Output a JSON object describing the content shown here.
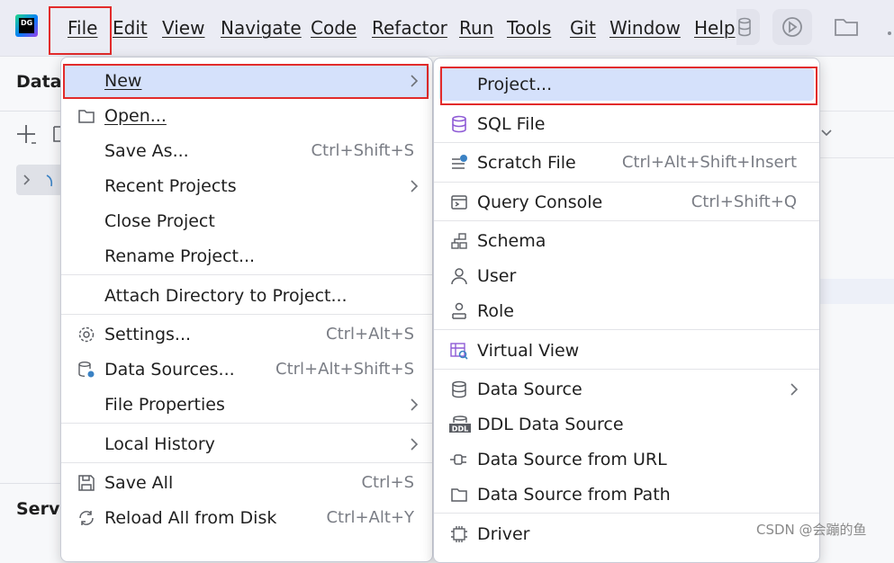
{
  "menubar": {
    "app_logo_text": "DG",
    "items": [
      "File",
      "Edit",
      "View",
      "Navigate",
      "Code",
      "Refactor",
      "Run",
      "Tools",
      "Git",
      "Window",
      "Help"
    ],
    "toolbar_icons": [
      "database-icon",
      "run-icon",
      "folder-icon"
    ]
  },
  "left_panel": {
    "title": "Data",
    "services_title": "Servi"
  },
  "file_menu": {
    "items": [
      {
        "label": "New",
        "shortcut": "",
        "icon": "",
        "submenu": true,
        "selected": true
      },
      {
        "label": "Open...",
        "shortcut": "",
        "icon": "folder-icon",
        "submenu": false
      },
      {
        "label": "Save As...",
        "shortcut": "Ctrl+Shift+S",
        "icon": "",
        "submenu": false
      },
      {
        "label": "Recent Projects",
        "shortcut": "",
        "icon": "",
        "submenu": true
      },
      {
        "label": "Close Project",
        "shortcut": "",
        "icon": "",
        "submenu": false
      },
      {
        "label": "Rename Project...",
        "shortcut": "",
        "icon": "",
        "submenu": false
      },
      {
        "label": "Attach Directory to Project...",
        "shortcut": "",
        "icon": "",
        "submenu": false
      },
      {
        "label": "Settings...",
        "shortcut": "Ctrl+Alt+S",
        "icon": "gear-icon",
        "submenu": false
      },
      {
        "label": "Data Sources...",
        "shortcut": "Ctrl+Alt+Shift+S",
        "icon": "data-sources-icon",
        "submenu": false
      },
      {
        "label": "File Properties",
        "shortcut": "",
        "icon": "",
        "submenu": true
      },
      {
        "label": "Local History",
        "shortcut": "",
        "icon": "",
        "submenu": true
      },
      {
        "label": "Save All",
        "shortcut": "Ctrl+S",
        "icon": "save-icon",
        "submenu": false
      },
      {
        "label": "Reload All from Disk",
        "shortcut": "Ctrl+Alt+Y",
        "icon": "reload-icon",
        "submenu": false
      }
    ]
  },
  "new_menu": {
    "items": [
      {
        "label": "Project...",
        "shortcut": "",
        "icon": "",
        "submenu": false,
        "selected": true
      },
      {
        "label": "SQL File",
        "shortcut": "",
        "icon": "sql-file-icon",
        "submenu": false
      },
      {
        "label": "Scratch File",
        "shortcut": "Ctrl+Alt+Shift+Insert",
        "icon": "scratch-file-icon",
        "submenu": false
      },
      {
        "label": "Query Console",
        "shortcut": "Ctrl+Shift+Q",
        "icon": "console-icon",
        "submenu": false
      },
      {
        "label": "Schema",
        "shortcut": "",
        "icon": "schema-icon",
        "submenu": false
      },
      {
        "label": "User",
        "shortcut": "",
        "icon": "user-icon",
        "submenu": false
      },
      {
        "label": "Role",
        "shortcut": "",
        "icon": "role-icon",
        "submenu": false
      },
      {
        "label": "Virtual View",
        "shortcut": "",
        "icon": "virtual-view-icon",
        "submenu": false
      },
      {
        "label": "Data Source",
        "shortcut": "",
        "icon": "database-icon",
        "submenu": true
      },
      {
        "label": "DDL Data Source",
        "shortcut": "",
        "icon": "ddl-icon",
        "submenu": false
      },
      {
        "label": "Data Source from URL",
        "shortcut": "",
        "icon": "url-plug-icon",
        "submenu": false
      },
      {
        "label": "Data Source from Path",
        "shortcut": "",
        "icon": "folder-icon",
        "submenu": false
      },
      {
        "label": "Driver",
        "shortcut": "",
        "icon": "driver-icon",
        "submenu": false
      }
    ]
  },
  "watermark": "CSDN @会蹦的鱼",
  "colors": {
    "selection": "#d5e1fb",
    "annotation_outline": "#e22b2b",
    "menubar_bg": "#ebecf4",
    "shortcut_text": "#7a7d85"
  }
}
